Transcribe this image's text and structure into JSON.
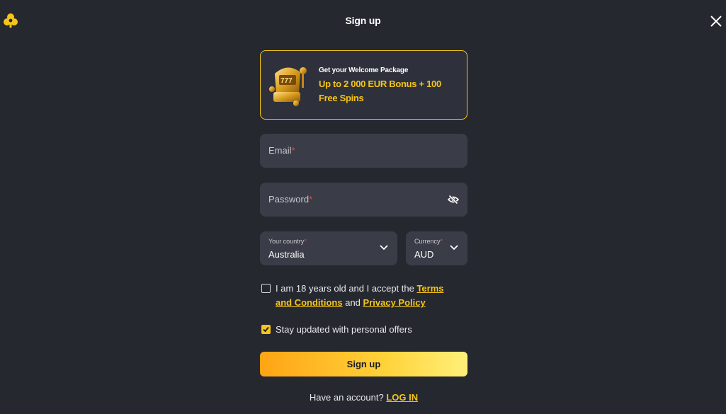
{
  "header": {
    "title": "Sign up",
    "logo_icon": "club-logo-icon",
    "close_icon": "close-icon"
  },
  "promo": {
    "subtitle": "Get your Welcome Package",
    "headline": "Up to 2 000 EUR Bonus + 100 Free Spins",
    "image_icon": "golden-slot-machine-icon"
  },
  "form": {
    "email": {
      "placeholder": "Email",
      "required_mark": "*",
      "value": ""
    },
    "password": {
      "placeholder": "Password",
      "required_mark": "*",
      "value": "",
      "toggle_icon": "eye-off-icon"
    },
    "country": {
      "label": "Your country",
      "required_mark": "*",
      "value": "Australia"
    },
    "currency": {
      "label": "Currency",
      "required_mark": "*",
      "value": "AUD"
    },
    "age_consent": {
      "checked": false,
      "text_before": "I am 18 years old and I accept the ",
      "terms_link": "Terms and Conditions",
      "text_middle": " and ",
      "privacy_link": "Privacy Policy"
    },
    "offers_consent": {
      "checked": true,
      "text": "Stay updated with personal offers"
    },
    "submit_label": "Sign up"
  },
  "footer": {
    "question": "Have an account? ",
    "login_link": "LOG IN"
  },
  "colors": {
    "background": "#262830",
    "accent": "#f5c518",
    "field_bg": "#3a3d47",
    "required": "#e5484d"
  }
}
